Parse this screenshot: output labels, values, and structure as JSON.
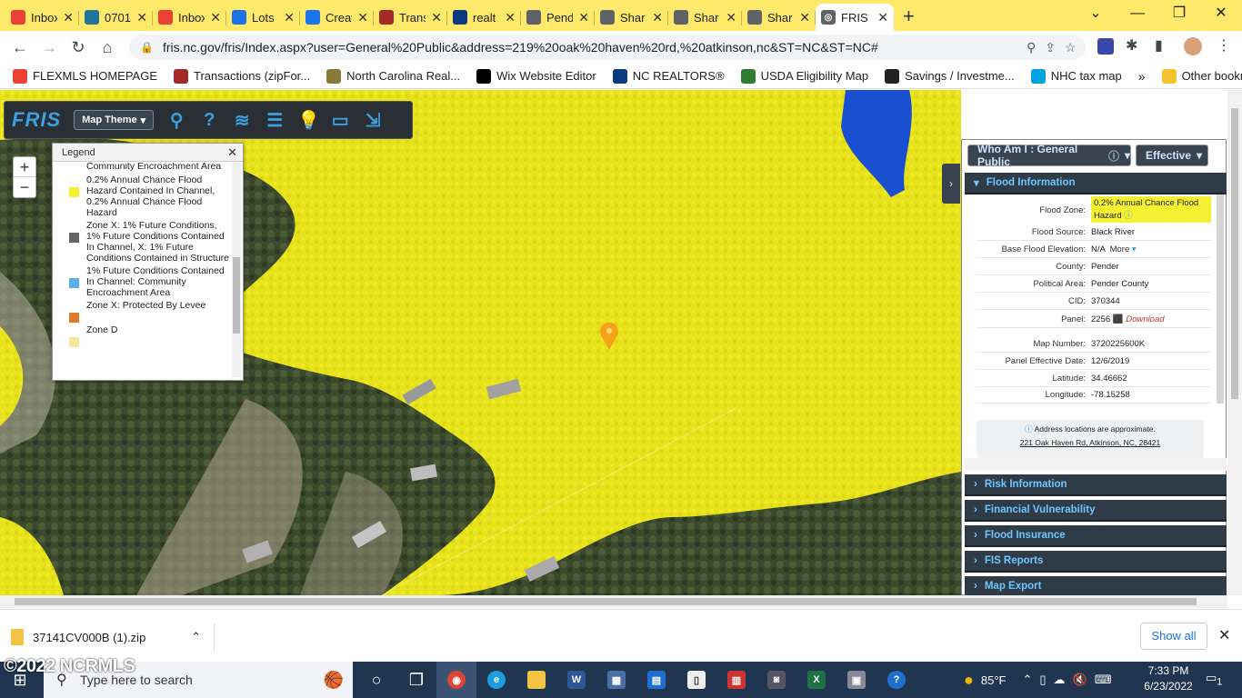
{
  "tabs": [
    {
      "label": "Inbox",
      "icon": "gmail-icon",
      "color": "#ea4335"
    },
    {
      "label": "0701",
      "icon": "wordpress-icon",
      "color": "#21759b"
    },
    {
      "label": "Inbox",
      "icon": "gmail-icon",
      "color": "#ea4335"
    },
    {
      "label": "Lots",
      "icon": "site-icon",
      "color": "#1a73e8"
    },
    {
      "label": "Creat",
      "icon": "site-icon",
      "color": "#1a73e8"
    },
    {
      "label": "Trans",
      "icon": "ziplogix-icon",
      "color": "#a52a2a"
    },
    {
      "label": "realt",
      "icon": "nc-realtors-icon",
      "color": "#0b3a82"
    },
    {
      "label": "Pend",
      "icon": "globe-icon",
      "color": "#5f6368"
    },
    {
      "label": "Shar",
      "icon": "globe-icon",
      "color": "#5f6368"
    },
    {
      "label": "Shar",
      "icon": "globe-icon",
      "color": "#5f6368"
    },
    {
      "label": "Shar",
      "icon": "globe-icon",
      "color": "#5f6368"
    }
  ],
  "active_tab": {
    "label": "FRIS"
  },
  "address_bar": {
    "url": "fris.nc.gov/fris/Index.aspx?user=General%20Public&address=219%20oak%20haven%20rd,%20atkinson,nc&ST=NC&ST=NC#"
  },
  "bookmarks": [
    {
      "label": "FLEXMLS HOMEPAGE",
      "color": "#ea4335"
    },
    {
      "label": "Transactions (zipFor...",
      "color": "#a52a2a"
    },
    {
      "label": "North Carolina Real...",
      "color": "#8a7a3a"
    },
    {
      "label": "Wix Website Editor",
      "color": "#000000"
    },
    {
      "label": "NC REALTORS®",
      "color": "#0b3a82"
    },
    {
      "label": "USDA Eligibility Map",
      "color": "#2e7d32"
    },
    {
      "label": "Savings / Investme...",
      "color": "#222222"
    },
    {
      "label": "NHC tax map",
      "color": "#00a3e0"
    }
  ],
  "other_bookmarks": "Other bookmarks",
  "fris": {
    "logo": "FRIS",
    "map_theme": "Map Theme"
  },
  "zoom": {
    "plus": "+",
    "minus": "−"
  },
  "legend": {
    "title": "Legend",
    "items": [
      {
        "label": "Community Encroachment Area",
        "color": ""
      },
      {
        "label": "0.2% Annual Chance Flood Hazard Contained In Channel, 0.2% Annual Chance Flood Hazard",
        "color": "#f5f032"
      },
      {
        "label": "Zone X: 1% Future Conditions, 1% Future Conditions Contained In Channel, X: 1% Future Conditions Contained in Structure",
        "color": "#666666"
      },
      {
        "label": "1% Future Conditions Contained In Channel: Community Encroachment Area",
        "color": "#5ab0e8"
      },
      {
        "label": "Zone X: Protected By Levee",
        "color": "#e07a2a"
      },
      {
        "label": "Zone D",
        "color": "#f5e6a0"
      }
    ]
  },
  "panel": {
    "who_am_i": "Who Am I : General Public",
    "effective": "Effective",
    "flood_section": "Flood Information",
    "fields": [
      {
        "key": "Flood Zone:",
        "value": "0.2% Annual Chance Flood Hazard"
      },
      {
        "key": "Flood Source:",
        "value": "Black River"
      },
      {
        "key": "Base Flood Elevation:",
        "value": "N/A"
      },
      {
        "key": "County:",
        "value": "Pender"
      },
      {
        "key": "Political Area:",
        "value": "Pender County"
      },
      {
        "key": "CID:",
        "value": "370344"
      },
      {
        "key": "Panel:",
        "value": "2256"
      },
      {
        "key": "Map Number:",
        "value": "3720225600K"
      },
      {
        "key": "Panel Effective Date:",
        "value": "12/6/2019"
      },
      {
        "key": "Latitude:",
        "value": "34.46662"
      },
      {
        "key": "Longitude:",
        "value": "-78.15258"
      }
    ],
    "more": "More",
    "download": "Download",
    "address_note": "Address locations are approximate.",
    "address": "221 Oak Haven Rd, Atkinson, NC, 28421",
    "sections": [
      "Risk Information",
      "Financial Vulnerability",
      "Flood Insurance",
      "FIS Reports",
      "Map Export"
    ]
  },
  "downloads": {
    "file": "37141CV000B (1).zip",
    "show_all": "Show all"
  },
  "taskbar": {
    "search_placeholder": "Type here to search",
    "weather": "85°F",
    "time": "7:33 PM",
    "date": "6/23/2022",
    "notifications": "1"
  },
  "watermark": "©2022 NCRMLS",
  "colors": {
    "flood_yellow": "#f2ee1a",
    "accent": "#6ec6ff"
  }
}
